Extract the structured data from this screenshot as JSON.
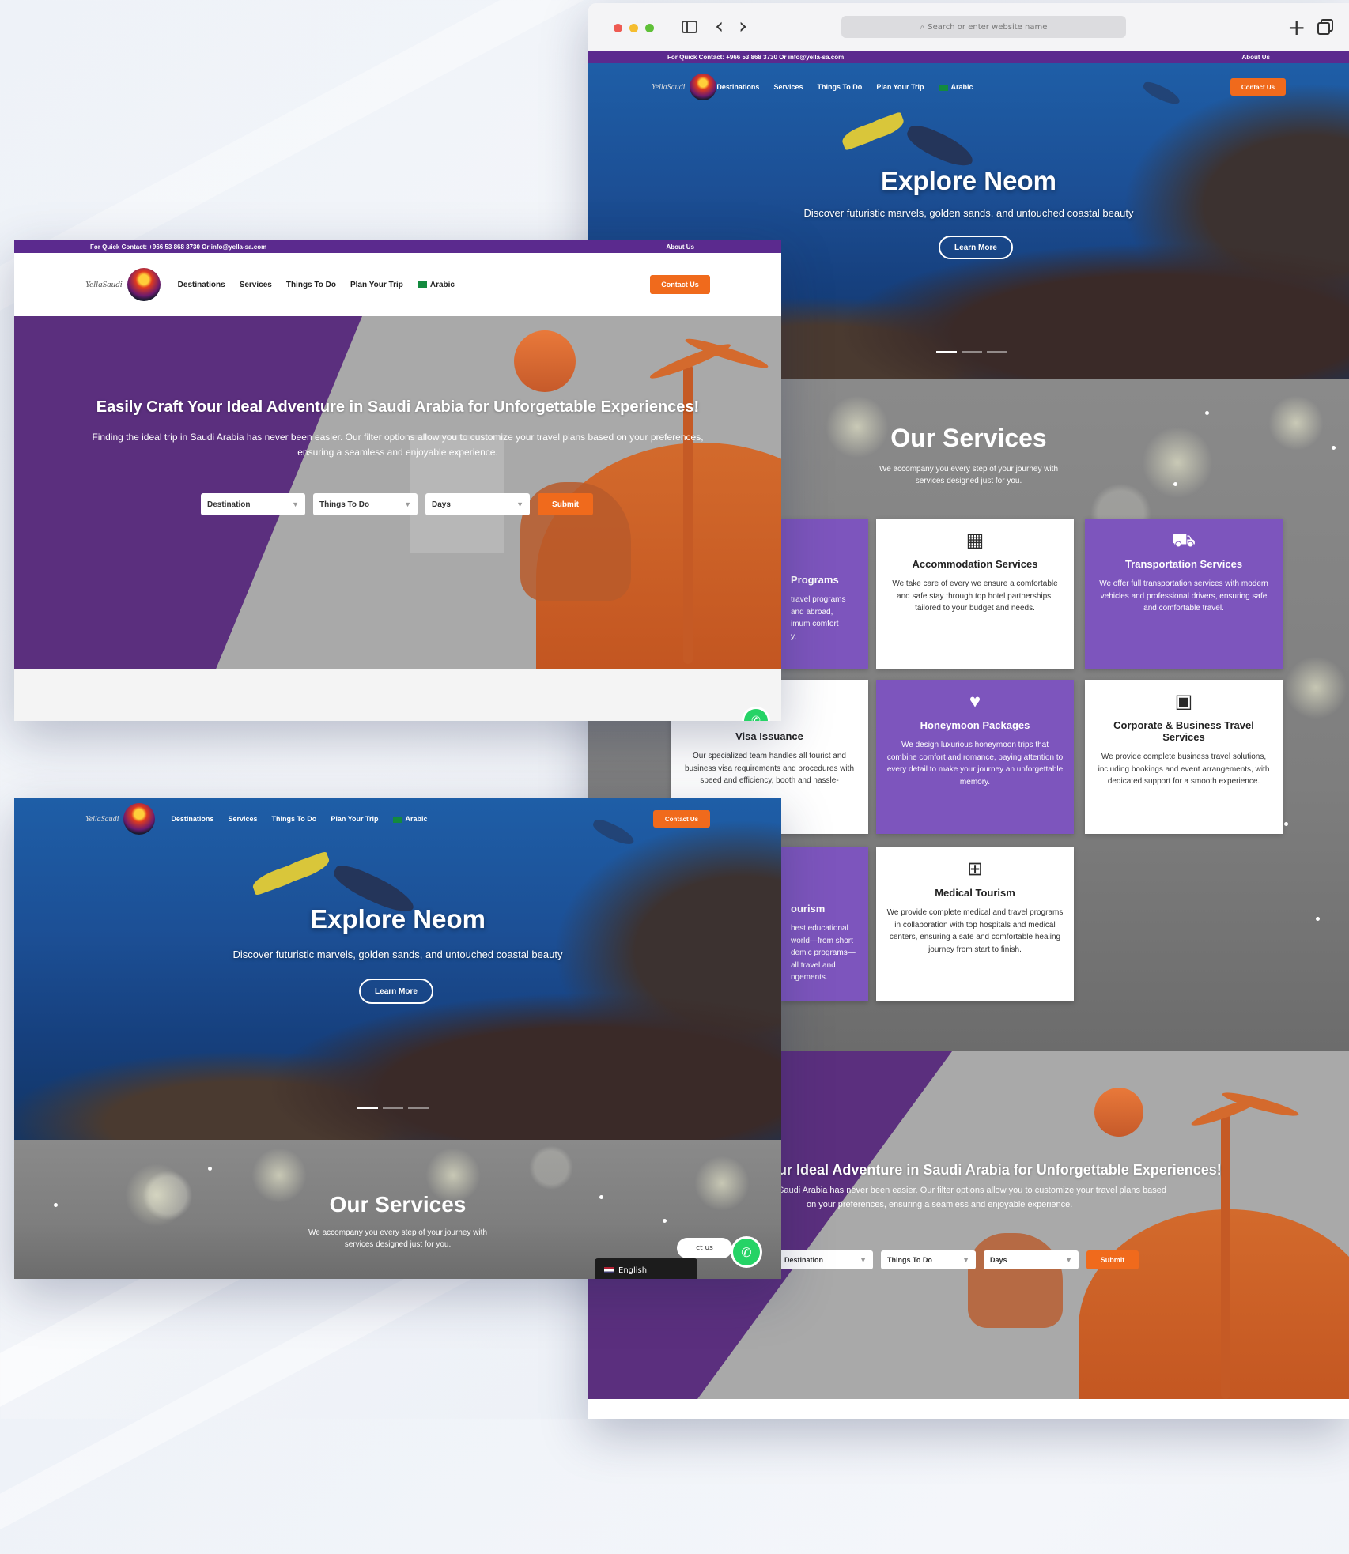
{
  "browser": {
    "address_placeholder": "Search or enter website name",
    "plus_glyph": "+",
    "back_glyph": "‹",
    "forward_glyph": "›"
  },
  "topbar": {
    "contact": "For Quick Contact: +966 53 868 3730 Or info@yella-sa.com",
    "about": "About Us"
  },
  "nav": {
    "items": [
      "Destinations",
      "Services",
      "Things To Do",
      "Plan Your Trip"
    ],
    "arabic": "Arabic",
    "contact_button": "Contact Us"
  },
  "hero_neom": {
    "title": "Explore Neom",
    "subtitle": "Discover futuristic marvels, golden sands, and untouched coastal beauty",
    "button": "Learn More"
  },
  "adventure": {
    "title": "Easily Craft Your Ideal Adventure in Saudi Arabia for Unforgettable Experiences!",
    "subtitle": "Finding the ideal trip in Saudi Arabia has never been easier. Our filter options allow you to customize your travel plans based on your preferences, ensuring a seamless and enjoyable experience.",
    "title_partial": "ur Ideal Adventure in Saudi Arabia for Unforgettable Experiences!",
    "sub_partial_1": "Saudi Arabia has never been easier. Our filter options allow you to customize your travel plans based",
    "sub_partial_2": "on your preferences, ensuring a seamless and enjoyable experience.",
    "filters": {
      "destination": "Destination",
      "things": "Things To Do",
      "days": "Days",
      "submit": "Submit"
    }
  },
  "services": {
    "title": "Our Services",
    "subtitle_line1": "We accompany you every step of your journey with",
    "subtitle_line2": "services designed just for you.",
    "cards": {
      "programs": {
        "title": "Programs",
        "desc": "travel programs\nand abroad,\nimum comfort\ny."
      },
      "accommodation": {
        "title": "Accommodation Services",
        "desc": "We take care of every we ensure a comfortable and safe stay through top hotel partnerships, tailored to your budget and needs."
      },
      "transportation": {
        "title": "Transportation Services",
        "desc": "We offer full transportation services with modern vehicles and professional drivers, ensuring safe and comfortable travel."
      },
      "visa": {
        "title": "Visa Issuance",
        "desc": "Our specialized team handles all tourist and business visa requirements and procedures with speed and efficiency, booth and hassle-"
      },
      "honeymoon": {
        "title": "Honeymoon Packages",
        "desc": "We design luxurious honeymoon trips that combine comfort and romance, paying attention to every detail to make your journey an unforgettable memory."
      },
      "corporate": {
        "title": "Corporate & Business Travel Services",
        "desc": "We provide complete business travel solutions, including bookings and event arrangements, with dedicated support for a smooth experience."
      },
      "tourism": {
        "title": "ourism",
        "desc": "best educational\nworld—from short\ndemic programs—\nall travel and\nngements."
      },
      "medical": {
        "title": "Medical Tourism",
        "desc": "We provide complete medical and travel programs in collaboration with top hospitals and medical centers, ensuring a safe and comfortable healing journey from start to finish."
      }
    },
    "icons": {
      "accommodation": "building-icon",
      "transportation": "bus-icon",
      "honeymoon": "heart-icon",
      "corporate": "briefcase-icon",
      "medical": "hospital-icon"
    }
  },
  "widgets": {
    "language": "English",
    "contact_partial": "ct us"
  },
  "colors": {
    "purple": "#5b2a8e",
    "card_purple": "#7d55bd",
    "orange": "#f06a1c",
    "whatsapp": "#25d366"
  }
}
